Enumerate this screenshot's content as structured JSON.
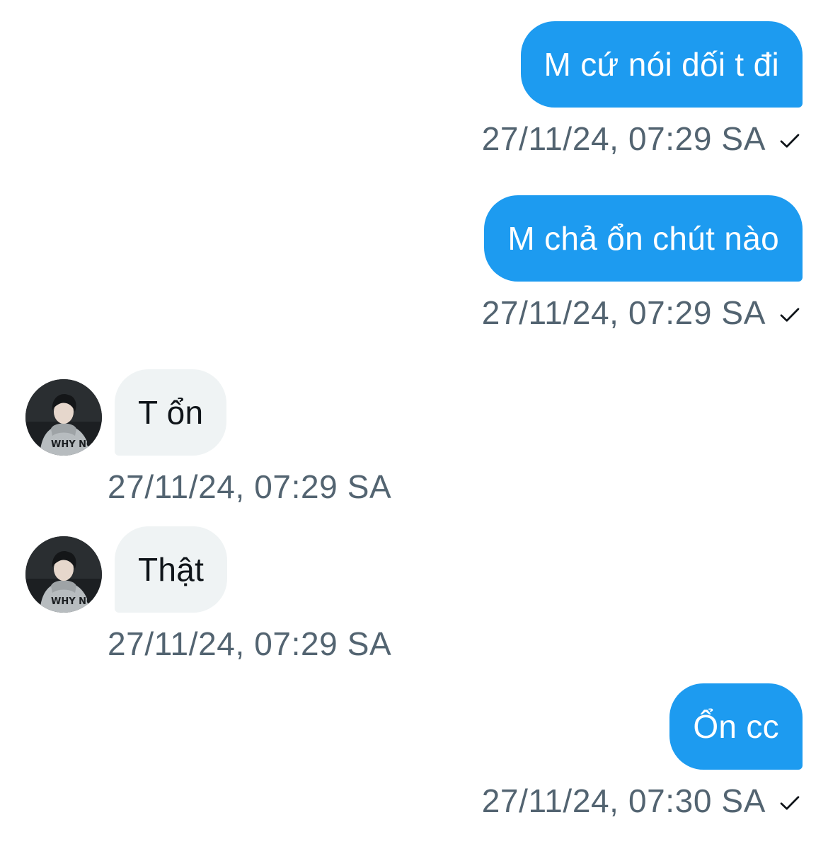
{
  "messages": [
    {
      "direction": "out",
      "text": "M cứ nói dối t đi",
      "timestamp": "27/11/24, 07:29 SA",
      "status_icon": "check-icon"
    },
    {
      "direction": "out",
      "text": "M chả ổn chút nào",
      "timestamp": "27/11/24, 07:29 SA",
      "status_icon": "check-icon"
    },
    {
      "direction": "in",
      "text": "T ổn",
      "timestamp": "27/11/24, 07:29 SA",
      "avatar": "user-avatar"
    },
    {
      "direction": "in",
      "text": "Thật",
      "timestamp": "27/11/24, 07:29 SA",
      "avatar": "user-avatar"
    },
    {
      "direction": "out",
      "text": "Ổn cc",
      "timestamp": "27/11/24, 07:30 SA",
      "status_icon": "check-icon"
    }
  ],
  "colors": {
    "outgoing_bubble": "#1d9bf0",
    "incoming_bubble": "#eff3f4",
    "timestamp_text": "#536471",
    "body_text": "#0f1419"
  }
}
